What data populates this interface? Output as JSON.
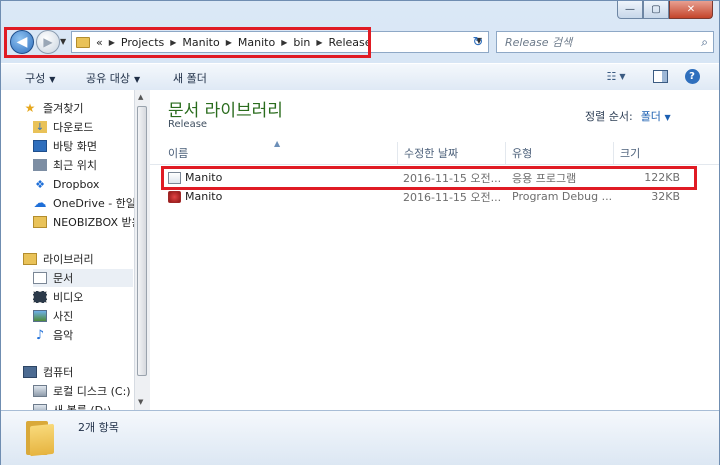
{
  "window": {
    "ghost_left": "",
    "ghost_right": ""
  },
  "caption_buttons": {
    "minimize": "—",
    "maximize": "▢",
    "close": "✕"
  },
  "address": {
    "overflow": "«",
    "crumbs": [
      "Projects",
      "Manito",
      "Manito",
      "bin",
      "Release"
    ]
  },
  "search": {
    "placeholder": "Release 검색"
  },
  "toolbar": {
    "organize": "구성",
    "share": "공유 대상",
    "new_folder": "새 폴더"
  },
  "nav": {
    "favorites": "즐겨찾기",
    "downloads": "다운로드",
    "desktop": "바탕 화면",
    "recent": "최근 위치",
    "dropbox": "Dropbox",
    "onedrive": "OneDrive - 한일",
    "neobizbox": "NEOBIZBOX 받은",
    "libraries": "라이브러리",
    "documents": "문서",
    "videos": "비디오",
    "pictures": "사진",
    "music": "음악",
    "computer": "컴퓨터",
    "local_disk": "로컬 디스크 (C:)",
    "new_volume": "새 볼륨 (D:)"
  },
  "main": {
    "title": "문서 라이브러리",
    "subtitle": "Release",
    "arrange_label": "정렬 순서:",
    "arrange_value": "폴더",
    "columns": [
      "이름",
      "수정한 날짜",
      "유형",
      "크기"
    ],
    "files": [
      {
        "name": "Manito",
        "date": "2016-11-15 오전...",
        "type": "응용 프로그램",
        "size": "122KB"
      },
      {
        "name": "Manito",
        "date": "2016-11-15 오전...",
        "type": "Program Debug ...",
        "size": "32KB"
      }
    ]
  },
  "status": {
    "count": "2개 항목"
  },
  "colors": {
    "highlight": "#e01b24",
    "title_green": "#2a6c1d",
    "link_blue": "#1b5fb2"
  }
}
